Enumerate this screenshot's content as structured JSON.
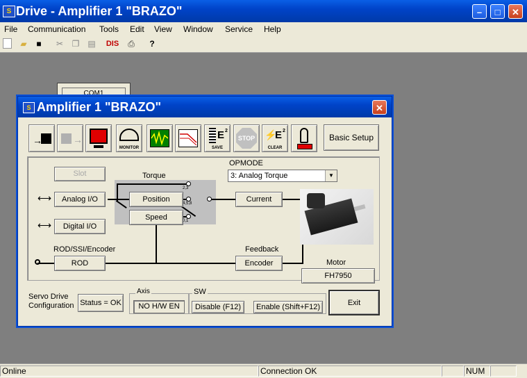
{
  "window": {
    "title": "Drive - Amplifier 1 \"BRAZO\"",
    "icon_letter": "S"
  },
  "menu": [
    "File",
    "Communication",
    "Tools",
    "Edit",
    "View",
    "Window",
    "Service",
    "Help"
  ],
  "toolbar": {
    "dis_label": "DIS",
    "help_glyph": "?"
  },
  "background_window": {
    "label": "COM1"
  },
  "dialog": {
    "title": "Amplifier 1 \"BRAZO\"",
    "toolbar_labels": {
      "monitor": "MONITOR",
      "save": "SAVE",
      "stop": "STOP",
      "clear": "CLEAR",
      "e2": "E",
      "e2_sup": "2"
    },
    "basic_setup": "Basic Setup",
    "diagram": {
      "slot": "Slot",
      "analog_io": "Analog I/O",
      "digital_io": "Digital I/O",
      "torque": "Torque",
      "position": "Position",
      "speed": "Speed",
      "switch_labels": {
        "top": "2,3",
        "mid": "4,5,8",
        "bot": "0,1"
      },
      "opmode_label": "OPMODE",
      "opmode_value": "3: Analog Torque",
      "current": "Current",
      "rod_label": "ROD/SSI/Encoder",
      "rod": "ROD",
      "feedback_label": "Feedback",
      "encoder": "Encoder",
      "motor_label": "Motor",
      "motor_value": "FH7950"
    },
    "bottom": {
      "servo_line1": "Servo Drive",
      "servo_line2": "Configuration",
      "status": "Status = OK",
      "axis_label": "Axis",
      "axis_value": "NO H/W EN",
      "sw_label": "SW",
      "disable": "Disable (F12)",
      "enable": "Enable (Shift+F12)",
      "exit": "Exit"
    }
  },
  "statusbar": {
    "left": "Online",
    "middle": "Connection OK",
    "num": "NUM"
  },
  "colors": {
    "title_blue": "#0043c8",
    "panel_bg": "#ece9d8",
    "desktop": "#7f7f7f",
    "close_red": "#c8401c"
  }
}
